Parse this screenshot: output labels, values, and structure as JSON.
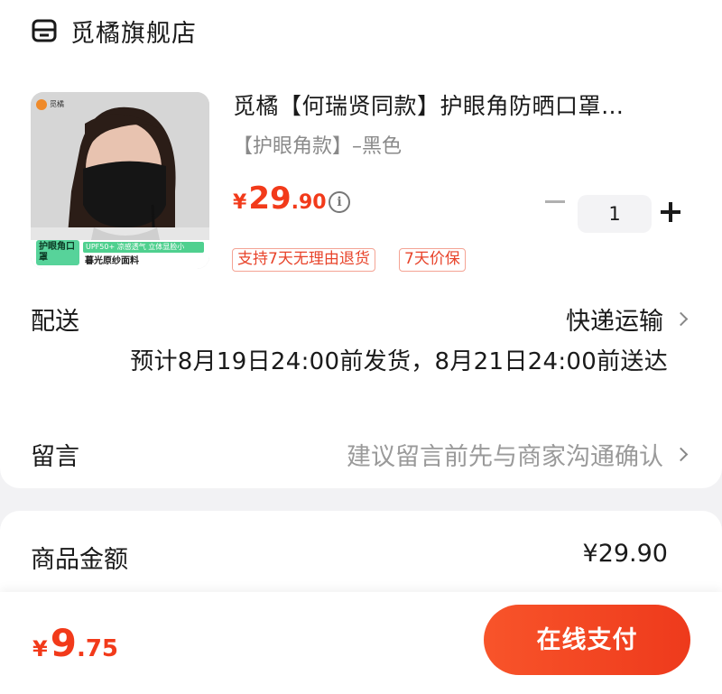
{
  "store": {
    "name": "觅橘旗舰店",
    "icon": "store-icon"
  },
  "product": {
    "title": "觅橘【何瑞贤同款】护眼角防晒口罩…",
    "variant": "【护眼角款】–黑色",
    "price_currency": "¥",
    "price_int": "29",
    "price_dec": ".90",
    "image": {
      "brand": "觅橘",
      "promo_green": "护眼角口罩",
      "promo_line1": "UPF50+ 凉感透气 立体显脸小",
      "promo_line2": "暮光原纱面料"
    },
    "quantity": "1",
    "tags": [
      "支持7天无理由退货",
      "7天价保"
    ]
  },
  "shipping": {
    "label": "配送",
    "method": "快递运输",
    "eta": "预计8月19日24:00前发货，8月21日24:00前送达"
  },
  "note": {
    "label": "留言",
    "placeholder": "建议留言前先与商家沟通确认"
  },
  "summary": {
    "label": "商品金额",
    "value": "¥29.90"
  },
  "footer": {
    "currency": "¥",
    "total_int": "9",
    "total_dec": ".75",
    "pay_label": "在线支付"
  },
  "colors": {
    "accent": "#f23a1a",
    "tag_border": "#f4a394",
    "background": "#f2f2f4"
  }
}
